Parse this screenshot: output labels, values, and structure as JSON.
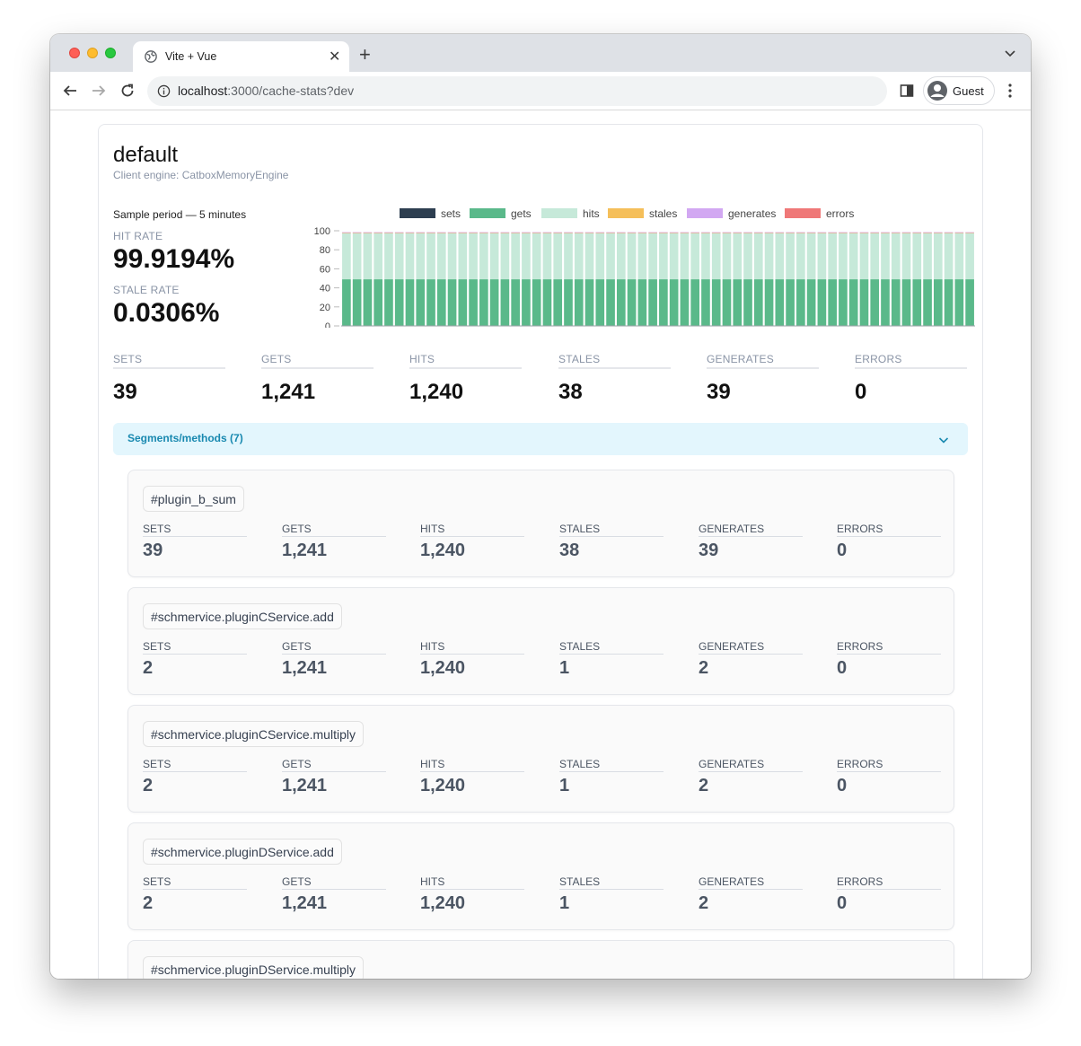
{
  "browser": {
    "tab_title": "Vite + Vue",
    "url_host": "localhost",
    "url_rest": ":3000/cache-stats?dev",
    "profile_label": "Guest"
  },
  "cache": {
    "name": "default",
    "engine_label": "Client engine:",
    "engine_value": "CatboxMemoryEngine",
    "sample_period": "Sample period — 5 minutes",
    "hit_rate_label": "HIT RATE",
    "hit_rate_value": "99.9194%",
    "stale_rate_label": "STALE RATE",
    "stale_rate_value": "0.0306%"
  },
  "totals": [
    {
      "label": "SETS",
      "value": "39"
    },
    {
      "label": "GETS",
      "value": "1,241"
    },
    {
      "label": "HITS",
      "value": "1,240"
    },
    {
      "label": "STALES",
      "value": "38"
    },
    {
      "label": "GENERATES",
      "value": "39"
    },
    {
      "label": "ERRORS",
      "value": "0"
    }
  ],
  "accordion": {
    "label": "Segments/methods (7)"
  },
  "segments": [
    {
      "name": "#plugin_b_sum",
      "stats": [
        {
          "label": "SETS",
          "value": "39"
        },
        {
          "label": "GETS",
          "value": "1,241"
        },
        {
          "label": "HITS",
          "value": "1,240"
        },
        {
          "label": "STALES",
          "value": "38"
        },
        {
          "label": "GENERATES",
          "value": "39"
        },
        {
          "label": "ERRORS",
          "value": "0"
        }
      ]
    },
    {
      "name": "#schmervice.pluginCService.add",
      "stats": [
        {
          "label": "SETS",
          "value": "2"
        },
        {
          "label": "GETS",
          "value": "1,241"
        },
        {
          "label": "HITS",
          "value": "1,240"
        },
        {
          "label": "STALES",
          "value": "1"
        },
        {
          "label": "GENERATES",
          "value": "2"
        },
        {
          "label": "ERRORS",
          "value": "0"
        }
      ]
    },
    {
      "name": "#schmervice.pluginCService.multiply",
      "stats": [
        {
          "label": "SETS",
          "value": "2"
        },
        {
          "label": "GETS",
          "value": "1,241"
        },
        {
          "label": "HITS",
          "value": "1,240"
        },
        {
          "label": "STALES",
          "value": "1"
        },
        {
          "label": "GENERATES",
          "value": "2"
        },
        {
          "label": "ERRORS",
          "value": "0"
        }
      ]
    },
    {
      "name": "#schmervice.pluginDService.add",
      "stats": [
        {
          "label": "SETS",
          "value": "2"
        },
        {
          "label": "GETS",
          "value": "1,241"
        },
        {
          "label": "HITS",
          "value": "1,240"
        },
        {
          "label": "STALES",
          "value": "1"
        },
        {
          "label": "GENERATES",
          "value": "2"
        },
        {
          "label": "ERRORS",
          "value": "0"
        }
      ]
    },
    {
      "name": "#schmervice.pluginDService.multiply",
      "stats": []
    }
  ],
  "chart_data": {
    "type": "bar",
    "stacked": true,
    "bar_count": 60,
    "ylim": [
      0,
      100
    ],
    "yticks": [
      0,
      20,
      40,
      60,
      80,
      100
    ],
    "legend_position": "top",
    "series": [
      {
        "name": "sets",
        "color": "#2d3e50",
        "values_per_bar": 0.5
      },
      {
        "name": "gets",
        "color": "#5ab98a",
        "values_per_bar": 48.5
      },
      {
        "name": "hits",
        "color": "#c6e9d9",
        "values_per_bar": 48.5
      },
      {
        "name": "stales",
        "color": "#f5bf5a",
        "values_per_bar": 0.5
      },
      {
        "name": "generates",
        "color": "#d2a8f2",
        "values_per_bar": 0.5
      },
      {
        "name": "errors",
        "color": "#ef7878",
        "values_per_bar": 0
      }
    ]
  }
}
